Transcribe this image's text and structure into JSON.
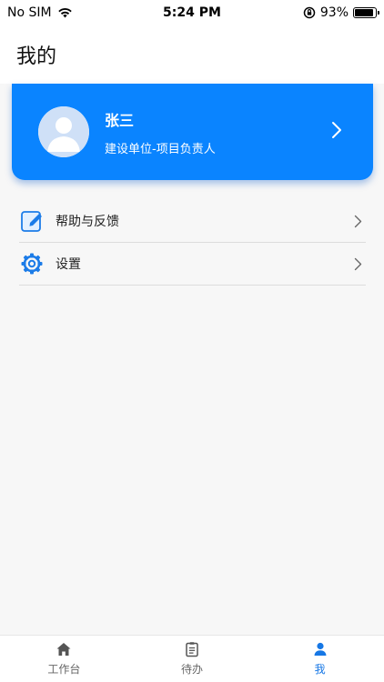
{
  "status_bar": {
    "carrier": "No SIM",
    "time": "5:24 PM",
    "battery_text": "93%",
    "battery_level": 0.93
  },
  "header": {
    "title": "我的"
  },
  "profile": {
    "name": "张三",
    "role": "建设单位-项目负责人"
  },
  "menu": {
    "items": [
      {
        "label": "帮助与反馈",
        "icon": "edit-note-icon"
      },
      {
        "label": "设置",
        "icon": "gear-icon"
      }
    ]
  },
  "tabs": [
    {
      "label": "工作台",
      "icon": "home-icon",
      "active": false
    },
    {
      "label": "待办",
      "icon": "clipboard-icon",
      "active": false
    },
    {
      "label": "我",
      "icon": "person-icon",
      "active": true
    }
  ],
  "colors": {
    "accent": "#0a84ff",
    "tab_active": "#1677e5"
  }
}
